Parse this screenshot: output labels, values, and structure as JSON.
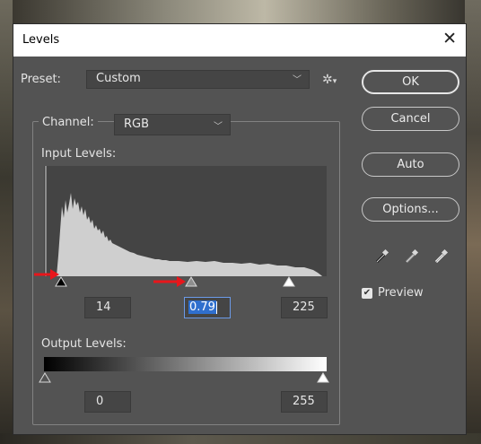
{
  "window": {
    "title": "Levels"
  },
  "preset": {
    "label": "Preset:",
    "value": "Custom"
  },
  "channel": {
    "label": "Channel:",
    "value": "RGB"
  },
  "input_levels": {
    "label": "Input Levels:",
    "black": "14",
    "gamma": "0.79",
    "white": "225"
  },
  "output_levels": {
    "label": "Output Levels:",
    "black": "0",
    "white": "255"
  },
  "buttons": {
    "ok": "OK",
    "cancel": "Cancel",
    "auto": "Auto",
    "options": "Options..."
  },
  "preview": {
    "label": "Preview",
    "checked": true
  },
  "accent": "#2f6fce",
  "annotation_color": "#e8161b"
}
